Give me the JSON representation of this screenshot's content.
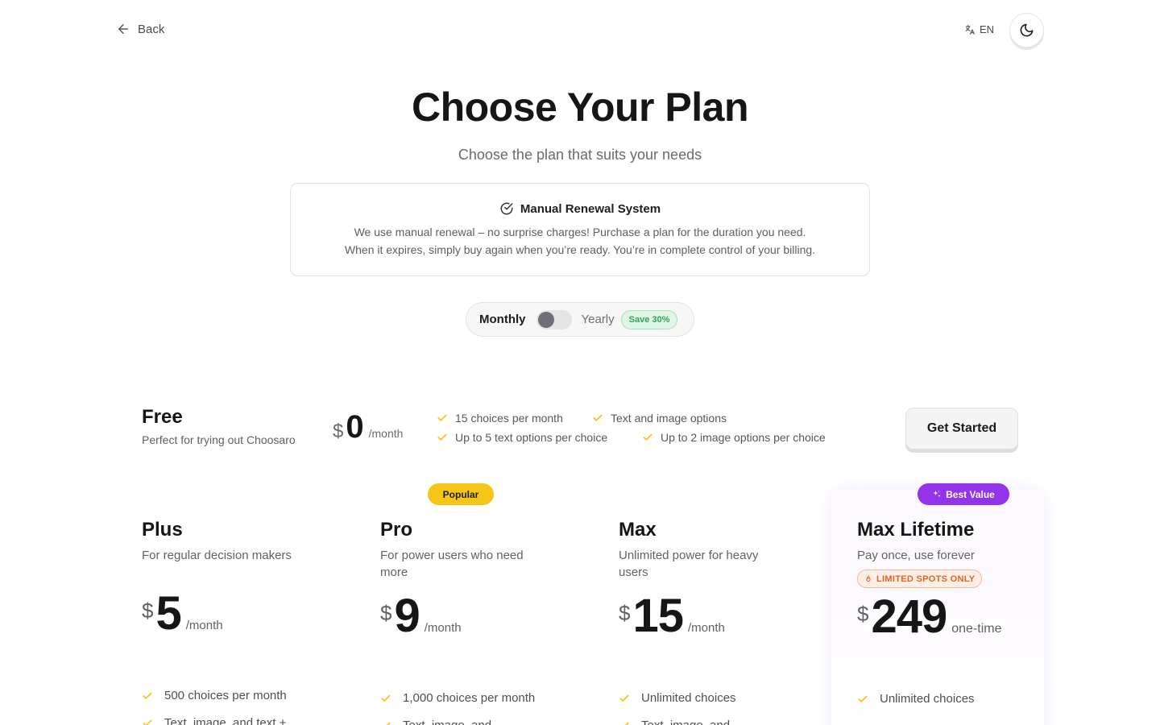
{
  "nav": {
    "back_label": "Back",
    "language": "EN"
  },
  "hero": {
    "title": "Choose Your Plan",
    "subtitle": "Choose the plan that suits your needs"
  },
  "notice": {
    "title": "Manual Renewal System",
    "line1": "We use manual renewal – no surprise charges! Purchase a plan for the duration you need.",
    "line2": "When it expires, simply buy again when you’re ready. You’re in complete control of your billing."
  },
  "billing": {
    "monthly_label": "Monthly",
    "yearly_label": "Yearly",
    "save_badge": "Save 30%",
    "yearly_selected": false
  },
  "free": {
    "name": "Free",
    "description": "Perfect for trying out Choosaro",
    "currency": "$",
    "price": "0",
    "period": "/month",
    "features": [
      "15 choices per month",
      "Text and image options",
      "Up to 5 text options per choice",
      "Up to 2 image options per choice"
    ],
    "cta": "Get Started"
  },
  "plans": [
    {
      "name": "Plus",
      "description": "For regular decision makers",
      "currency": "$",
      "price": "5",
      "period": "/month",
      "badge": "",
      "features": [
        "500 choices per month",
        "Text, image, and text +"
      ]
    },
    {
      "name": "Pro",
      "description": "For power users who need more",
      "currency": "$",
      "price": "9",
      "period": "/month",
      "badge": "Popular",
      "features": [
        "1,000 choices per month",
        "Text, image, and"
      ]
    },
    {
      "name": "Max",
      "description": "Unlimited power for heavy users",
      "currency": "$",
      "price": "15",
      "period": "/month",
      "badge": "",
      "features": [
        "Unlimited choices",
        "Text, image, and"
      ]
    },
    {
      "name": "Max Lifetime",
      "description": "Pay once, use forever",
      "currency": "$",
      "price": "249",
      "period": "one-time",
      "badge": "Best Value",
      "limited": "LIMITED SPOTS ONLY",
      "features": [
        "Unlimited choices"
      ]
    }
  ],
  "colors": {
    "check": "#f5c518",
    "popular": "#f5c518",
    "best_value": "#9333ea",
    "limited": "#e06526",
    "save": "#2fa35a"
  }
}
